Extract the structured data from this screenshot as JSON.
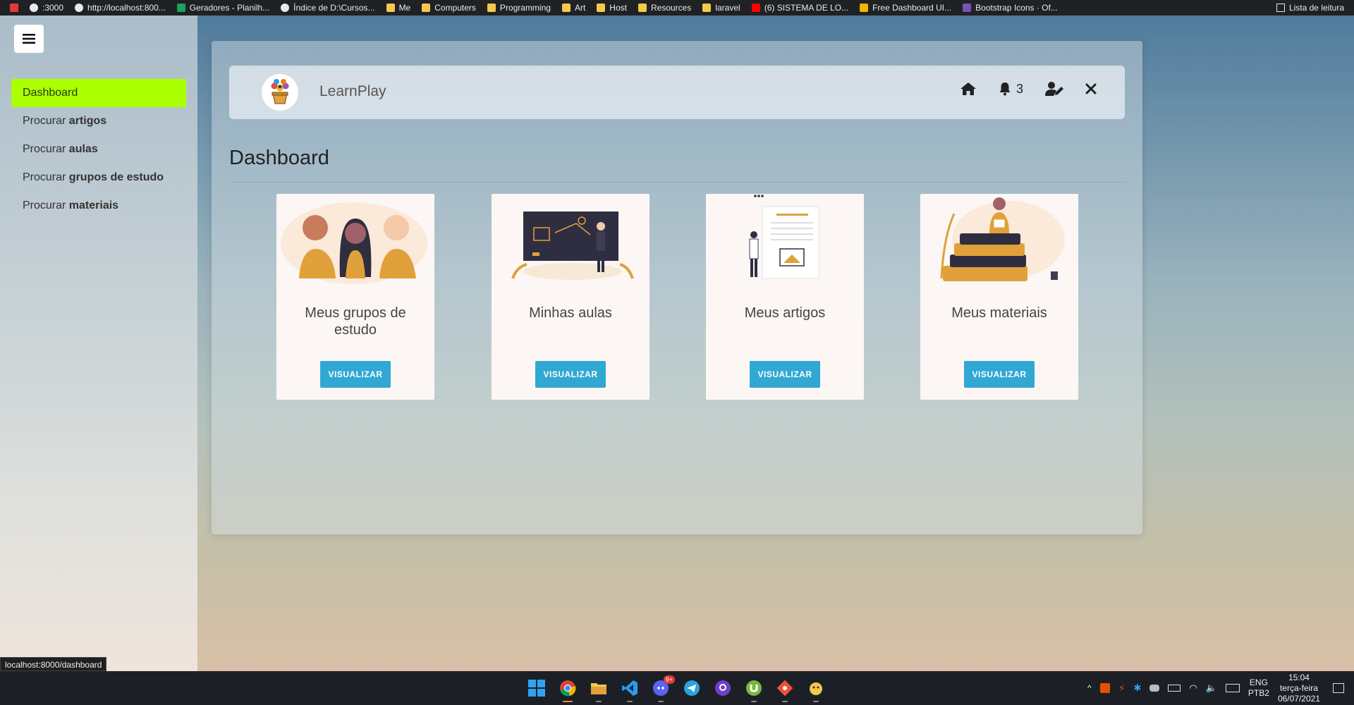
{
  "browser": {
    "bookmarks": [
      {
        "label": ":3000",
        "icon": "globe-icon"
      },
      {
        "label": "http://localhost:800...",
        "icon": "globe-icon"
      },
      {
        "label": "Geradores - Planilh...",
        "icon": "sheets-icon"
      },
      {
        "label": "Índice de D:\\Cursos...",
        "icon": "globe-icon"
      },
      {
        "label": "Me",
        "icon": "folder-icon"
      },
      {
        "label": "Computers",
        "icon": "folder-icon"
      },
      {
        "label": "Programming",
        "icon": "folder-icon"
      },
      {
        "label": "Art",
        "icon": "folder-icon"
      },
      {
        "label": "Host",
        "icon": "folder-icon"
      },
      {
        "label": "Resources",
        "icon": "folder-icon"
      },
      {
        "label": "laravel",
        "icon": "folder-icon"
      },
      {
        "label": "(6) SISTEMA DE LO...",
        "icon": "youtube-icon"
      },
      {
        "label": "Free Dashboard UI...",
        "icon": "bookmark-icon"
      },
      {
        "label": "Bootstrap Icons · Of...",
        "icon": "bootstrap-icon"
      }
    ],
    "reading_list": "Lista de leitura",
    "status_url": "localhost:8000/dashboard"
  },
  "sidebar": {
    "items": [
      {
        "prefix": "",
        "bold": "Dashboard",
        "active": true
      },
      {
        "prefix": "Procurar ",
        "bold": "artigos",
        "active": false
      },
      {
        "prefix": "Procurar ",
        "bold": "aulas",
        "active": false
      },
      {
        "prefix": "Procurar ",
        "bold": "grupos de estudo",
        "active": false
      },
      {
        "prefix": "Procurar ",
        "bold": "materiais",
        "active": false
      }
    ],
    "active_color": "#aaff00"
  },
  "header": {
    "brand": "LearnPlay",
    "notification_count": "3"
  },
  "page": {
    "title": "Dashboard"
  },
  "cards": [
    {
      "title": "Meus grupos de estudo",
      "button": "VISUALIZAR",
      "art": "study-group-illustration"
    },
    {
      "title": "Minhas aulas",
      "button": "VISUALIZAR",
      "art": "classroom-illustration"
    },
    {
      "title": "Meus artigos",
      "button": "VISUALIZAR",
      "art": "article-illustration"
    },
    {
      "title": "Meus materiais",
      "button": "VISUALIZAR",
      "art": "books-illustration"
    }
  ],
  "accent_color": "#31a8d3",
  "taskbar": {
    "apps": [
      "windows-start-icon",
      "chrome-icon",
      "file-explorer-icon",
      "vscode-icon",
      "discord-icon",
      "telegram-icon",
      "github-icon",
      "utorrent-icon",
      "git-icon",
      "app-icon"
    ],
    "discord_badge": "9+",
    "lang_top": "ENG",
    "lang_bottom": "PTB2",
    "time": "15:04",
    "day": "terça-feira",
    "date": "06/07/2021"
  }
}
